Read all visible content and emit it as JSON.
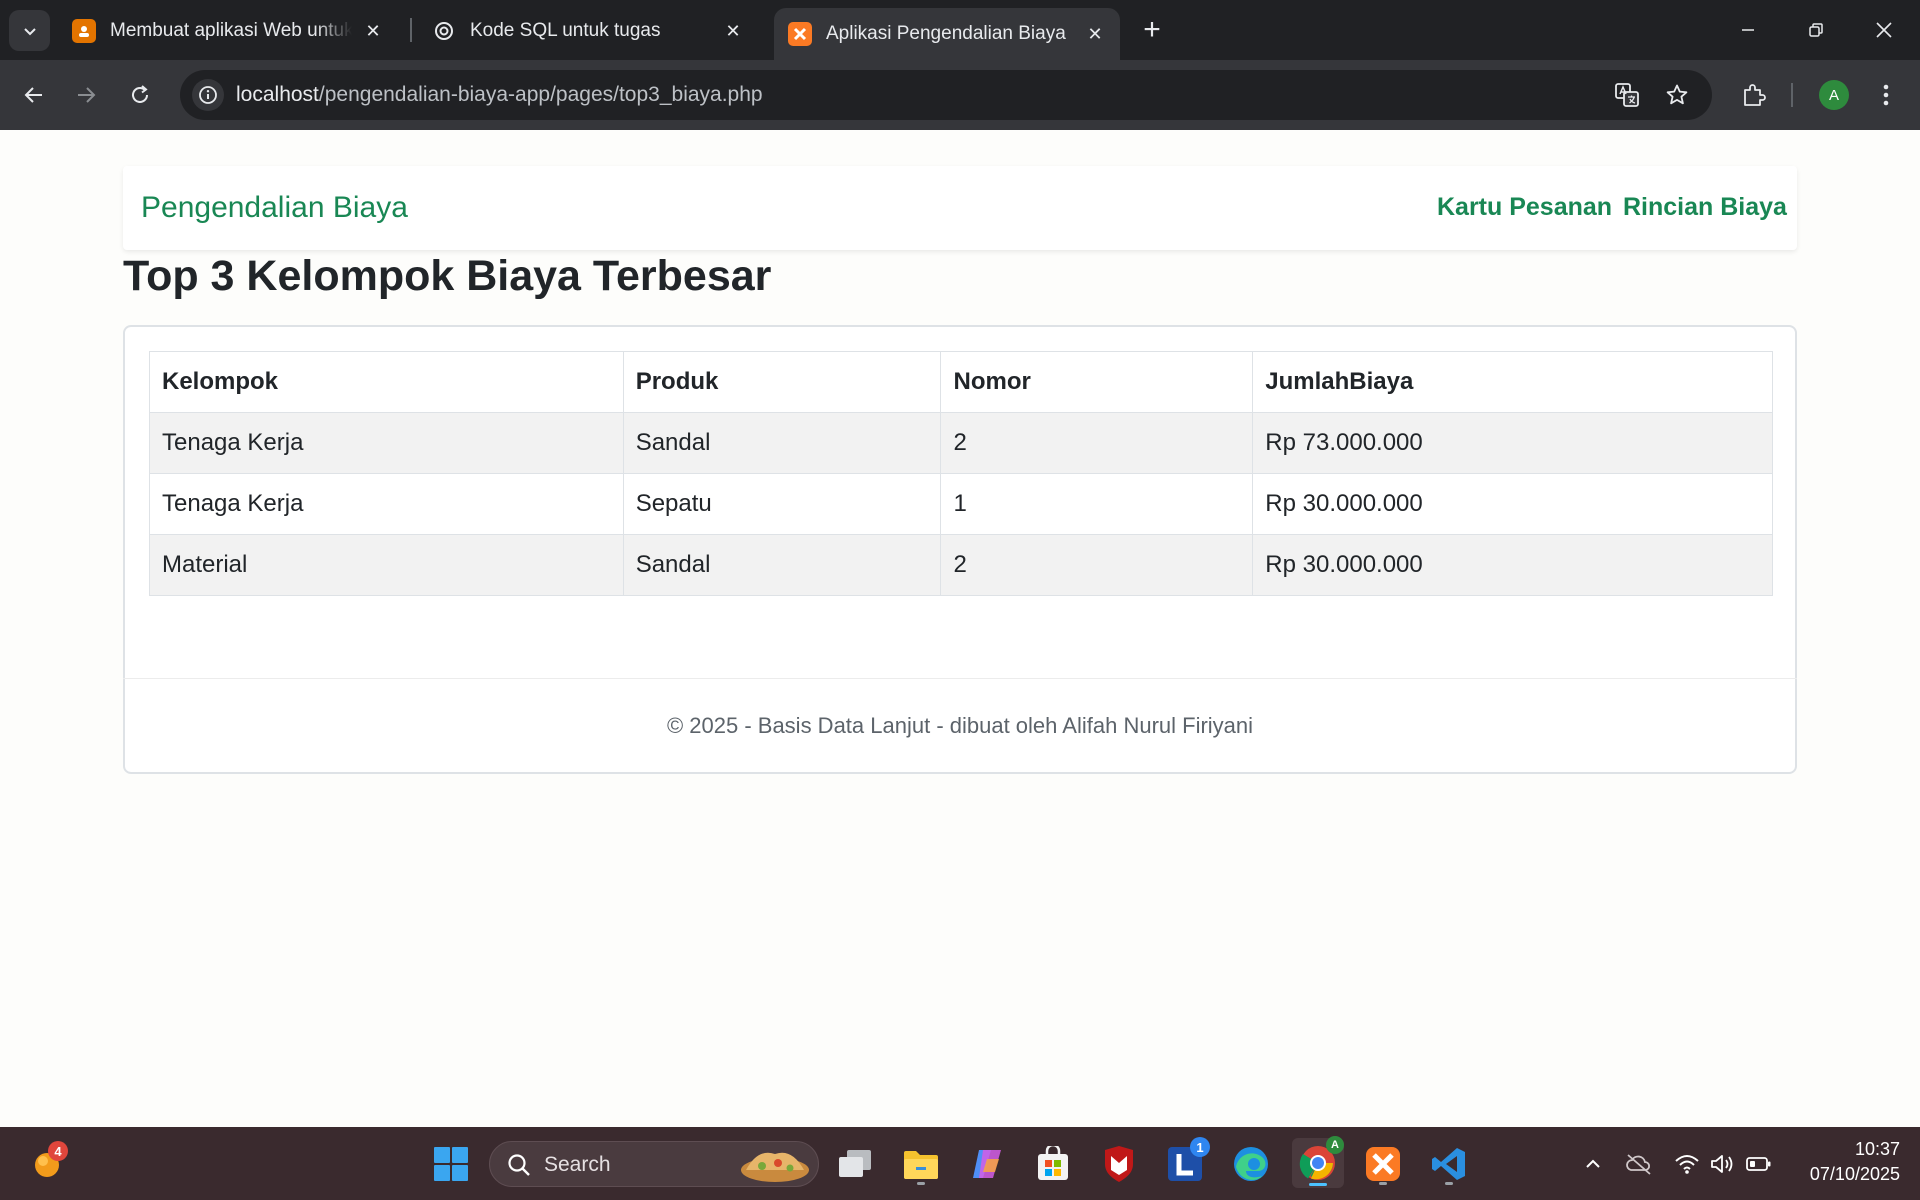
{
  "browser": {
    "tabs": [
      {
        "title": "Membuat aplikasi Web untuk P",
        "active": false
      },
      {
        "title": "Kode SQL untuk tugas",
        "active": false
      },
      {
        "title": "Aplikasi Pengendalian Biaya",
        "active": true
      }
    ],
    "url_host": "localhost",
    "url_path": "/pengendalian-biaya-app/pages/top3_biaya.php",
    "profile_initial": "A"
  },
  "page": {
    "brand": "Pengendalian Biaya",
    "nav": [
      {
        "label": "Kartu Pesanan"
      },
      {
        "label": "Rincian Biaya"
      }
    ],
    "title": "Top 3 Kelompok Biaya Terbesar",
    "table": {
      "headers": [
        "Kelompok",
        "Produk",
        "Nomor",
        "JumlahBiaya"
      ],
      "rows": [
        [
          "Tenaga Kerja",
          "Sandal",
          "2",
          "Rp 73.000.000"
        ],
        [
          "Tenaga Kerja",
          "Sepatu",
          "1",
          "Rp 30.000.000"
        ],
        [
          "Material",
          "Sandal",
          "2",
          "Rp 30.000.000"
        ]
      ]
    },
    "footer": "© 2025 - Basis Data Lanjut - dibuat oleh Alifah Nurul Firiyani"
  },
  "taskbar": {
    "search_label": "Search",
    "widget_badge": "4",
    "lumi_badge": "1",
    "time": "10:37",
    "date": "07/10/2025"
  },
  "colors": {
    "accent": "#198754",
    "chrome_dark": "#202124",
    "chrome_mid": "#35363a",
    "taskbar": "#3a2a2e"
  }
}
